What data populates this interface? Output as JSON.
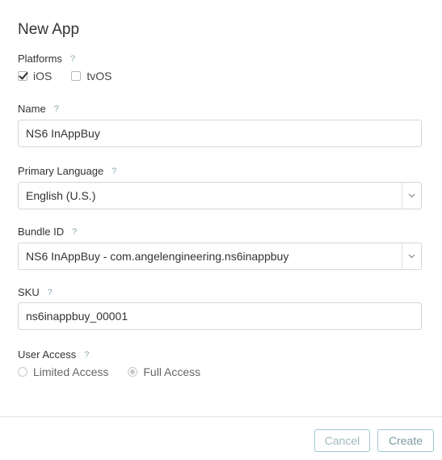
{
  "dialog": {
    "title": "New App",
    "help_glyph": "?"
  },
  "platforms": {
    "label": "Platforms",
    "options": [
      {
        "label": "iOS",
        "checked": true
      },
      {
        "label": "tvOS",
        "checked": false
      }
    ]
  },
  "name": {
    "label": "Name",
    "value": "NS6 InAppBuy"
  },
  "primary_language": {
    "label": "Primary Language",
    "selected": "English (U.S.)"
  },
  "bundle_id": {
    "label": "Bundle ID",
    "selected": "NS6 InAppBuy - com.angelengineering.ns6inappbuy"
  },
  "sku": {
    "label": "SKU",
    "value": "ns6inappbuy_00001"
  },
  "user_access": {
    "label": "User Access",
    "options": [
      {
        "label": "Limited Access",
        "selected": false
      },
      {
        "label": "Full Access",
        "selected": true
      }
    ]
  },
  "footer": {
    "cancel_label": "Cancel",
    "create_label": "Create"
  },
  "colors": {
    "button_border": "#9cc8d4",
    "help_icon": "#8aa8b0"
  },
  "icons": {
    "help": "question-mark-icon",
    "dropdown": "chevron-down-icon"
  }
}
